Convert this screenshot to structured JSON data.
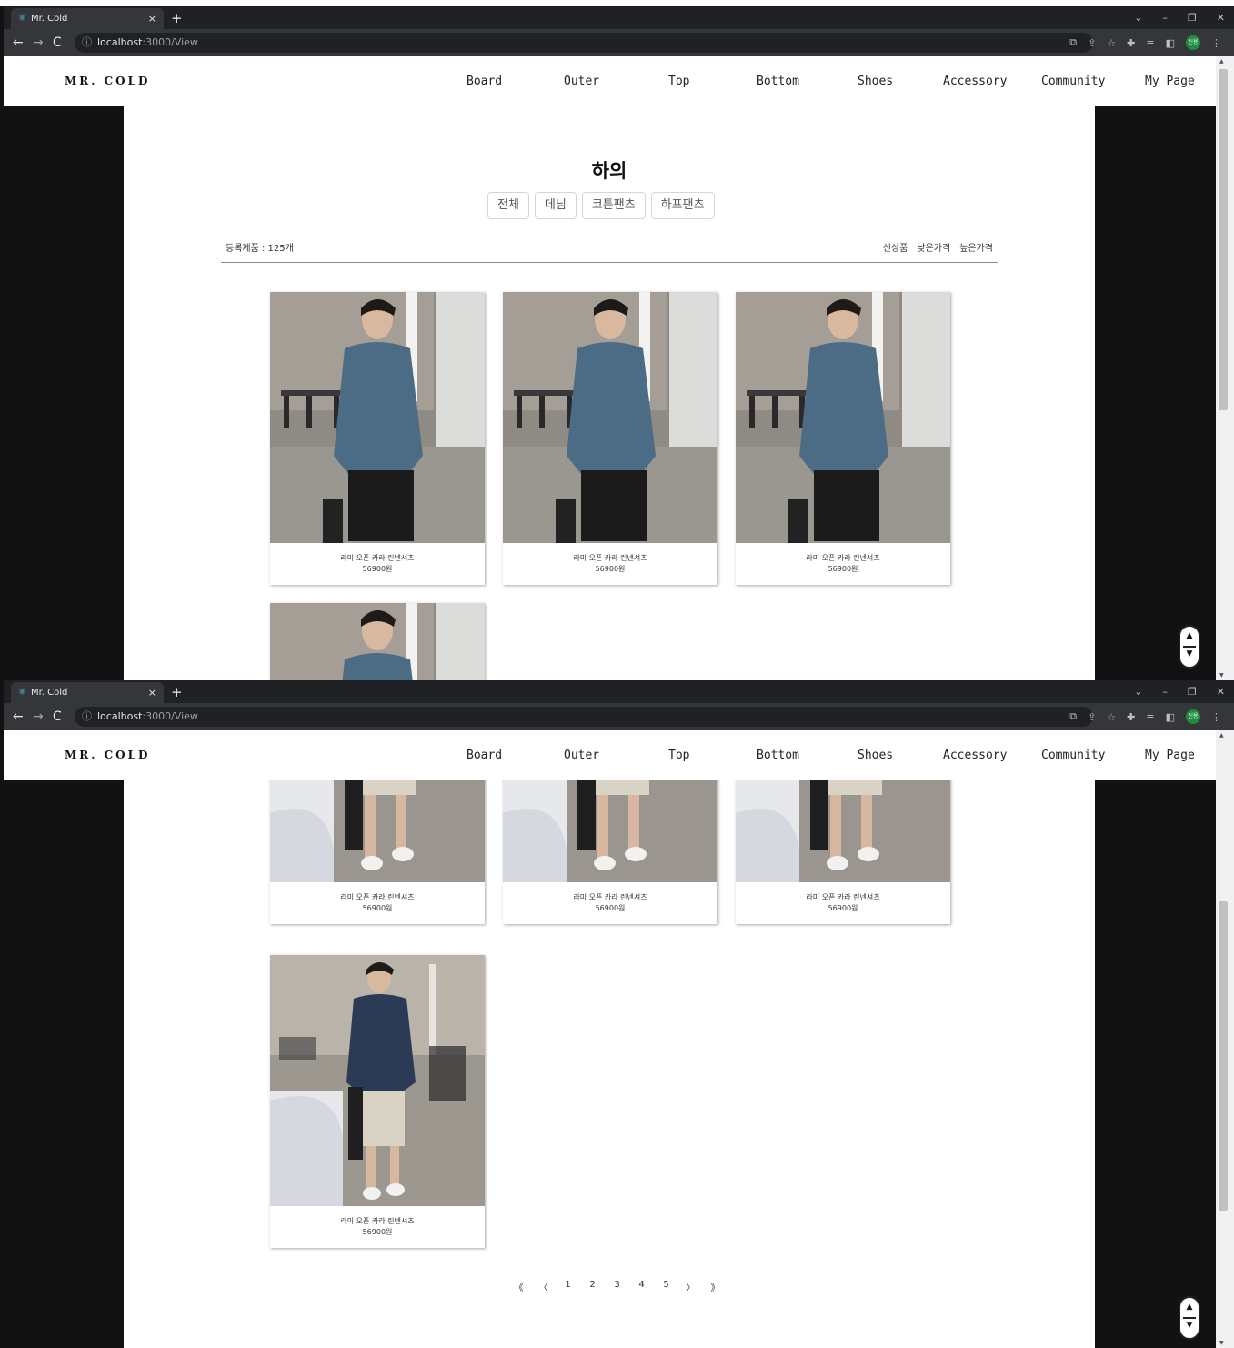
{
  "browser": {
    "tab_title": "Mr. Cold",
    "tab_close": "×",
    "new_tab": "+",
    "url_host": "localhost",
    "url_path": ":3000/View",
    "profile_label": "신용"
  },
  "nav": {
    "logo": "MR. COLD",
    "items": [
      "Board",
      "Outer",
      "Top",
      "Bottom",
      "Shoes",
      "Accessory",
      "Community",
      "My Page"
    ]
  },
  "page": {
    "title": "하의",
    "filters": [
      "전체",
      "데님",
      "코튼팬츠",
      "하프팬츠"
    ],
    "count_label": "등록제품 : 125개",
    "sorts": [
      "신상품",
      "낮은가격",
      "높은가격"
    ]
  },
  "products": [
    {
      "name": "라미 오픈 카라 린넨셔츠",
      "price": "56900원"
    },
    {
      "name": "라미 오픈 카라 린넨셔츠",
      "price": "56900원"
    },
    {
      "name": "라미 오픈 카라 린넨셔츠",
      "price": "56900원"
    },
    {
      "name": "라미 오픈 카라 린넨셔츠",
      "price": "56900원"
    }
  ],
  "pagination": {
    "first": "《",
    "prev": "〈",
    "pages": [
      "1",
      "2",
      "3",
      "4",
      "5"
    ],
    "next": "〉",
    "last": "》"
  },
  "scroll_button": {
    "up": "▲",
    "down": "▼"
  },
  "colors": {
    "chrome_dark": "#202124",
    "chrome_bar": "#35363a",
    "page_bg": "#121212",
    "shirt_blue": "#4c6b85",
    "shirt_navy": "#2b3a55"
  }
}
